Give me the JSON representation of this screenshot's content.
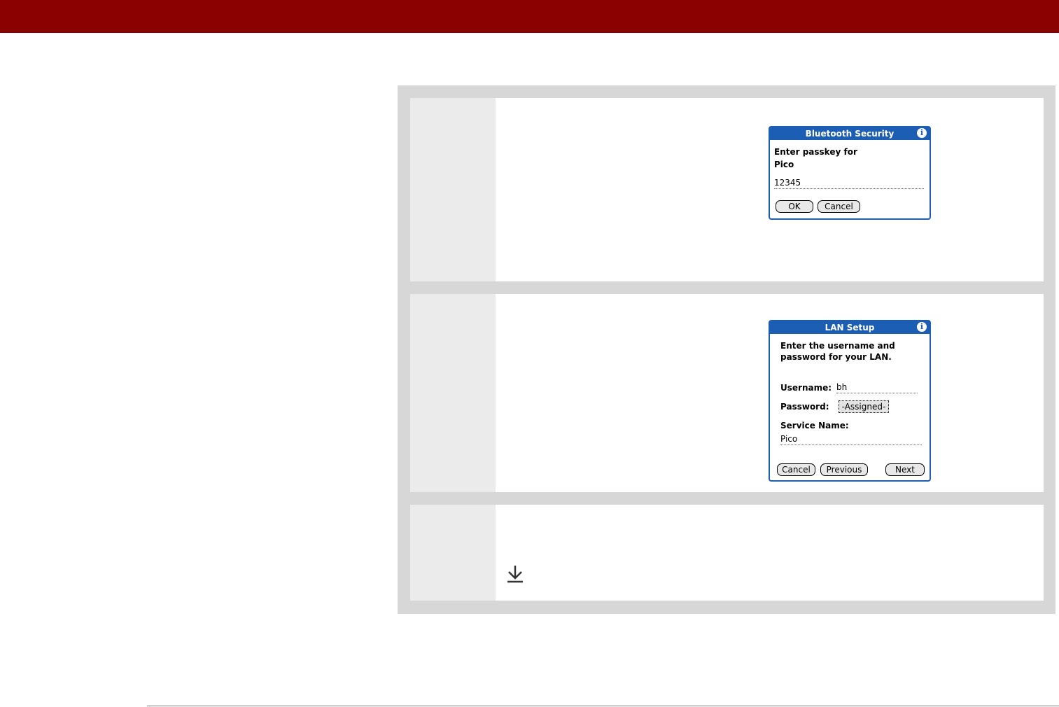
{
  "bt_dialog": {
    "title": "Bluetooth Security",
    "prompt_line1": "Enter passkey for",
    "prompt_line2": "Pico",
    "passkey_value": "12345",
    "ok_label": "OK",
    "cancel_label": "Cancel"
  },
  "lan_dialog": {
    "title": "LAN Setup",
    "prompt_line1": "Enter the username and",
    "prompt_line2": "password for your LAN.",
    "username_label": "Username:",
    "username_value": "bh",
    "password_label": "Password:",
    "password_button": "-Assigned-",
    "service_label": "Service Name:",
    "service_value": "Pico",
    "cancel_label": "Cancel",
    "previous_label": "Previous",
    "next_label": "Next"
  },
  "icons": {
    "info": "info-icon",
    "download": "download-arrow-icon"
  },
  "colors": {
    "header_bar": "#8b0000",
    "dialog_blue": "#1d5eb5",
    "panel_gray": "#d7d7d7"
  }
}
